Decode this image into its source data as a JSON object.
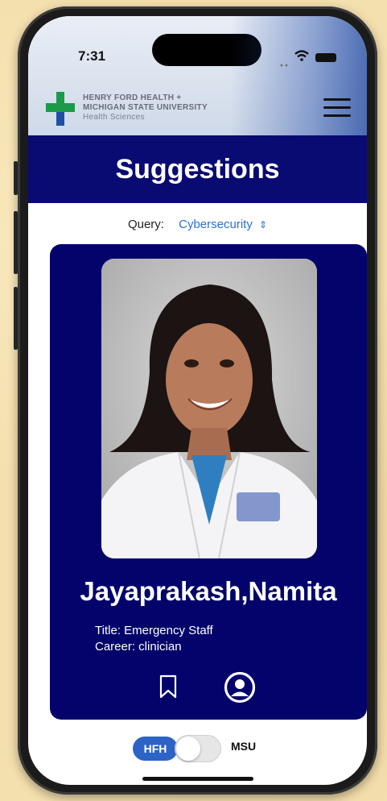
{
  "status_bar": {
    "time": "7:31"
  },
  "header": {
    "logo_line1": "HENRY FORD HEALTH +",
    "logo_line2": "MICHIGAN STATE UNIVERSITY",
    "logo_line3": "Health Sciences"
  },
  "banner": {
    "title": "Suggestions"
  },
  "query": {
    "label": "Query:",
    "value": "Cybersecurity",
    "chevron": "⇕"
  },
  "card": {
    "name": "Jayaprakash,Namita",
    "title_line": "Title: Emergency Staff",
    "career_line": "Career: clinician"
  },
  "toggle": {
    "left_label": "HFH",
    "right_label": "MSU",
    "state": "HFH"
  },
  "colors": {
    "banner": "#0a0a73",
    "card": "#03036b",
    "accent": "#2a6fd6",
    "pill": "#2d63c7",
    "logo_green": "#1b9a4a",
    "logo_blue": "#1f4fa5"
  },
  "icons": [
    "wifi-icon",
    "battery-icon",
    "menu-icon",
    "bookmark-icon",
    "profile-icon"
  ]
}
